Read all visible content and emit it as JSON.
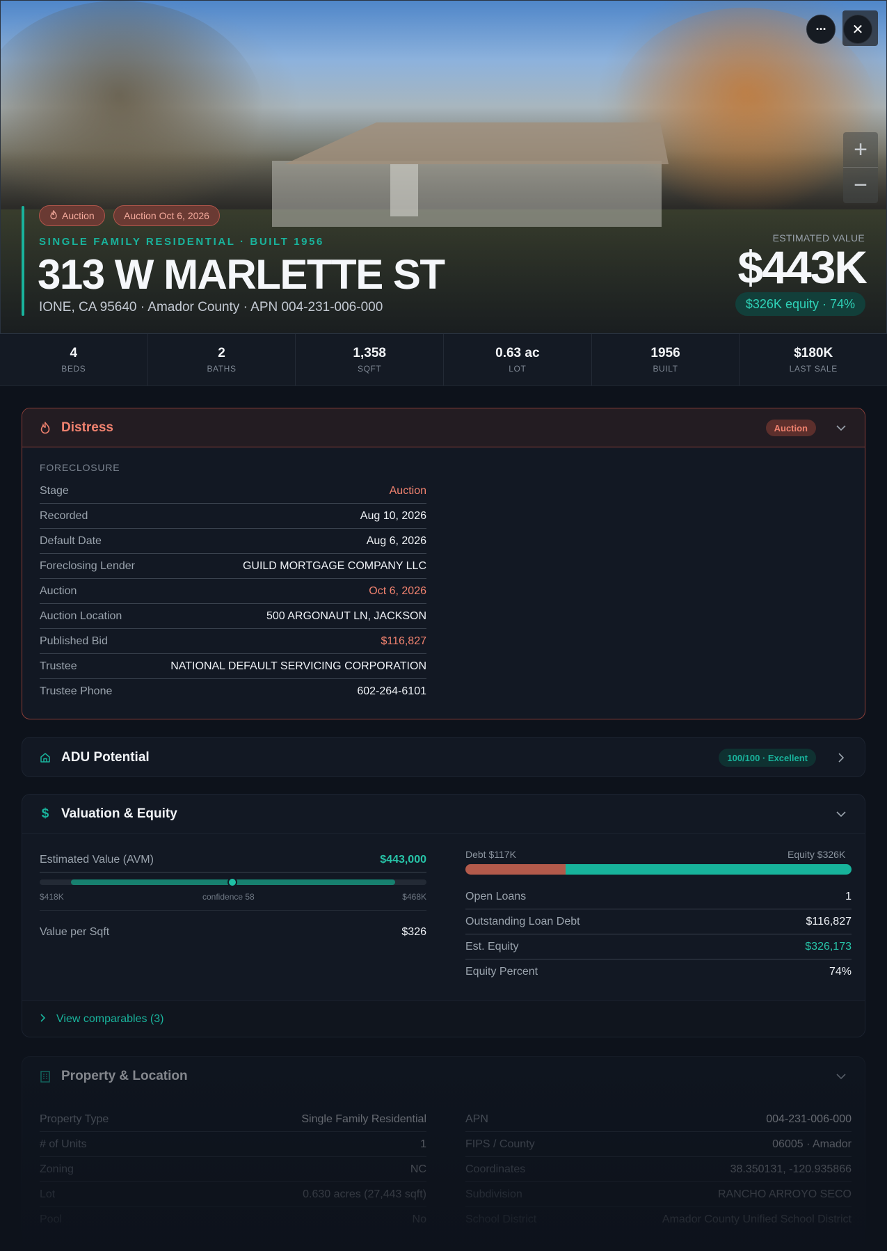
{
  "hero": {
    "chips": [
      {
        "label": "Auction"
      },
      {
        "label": "Auction Oct 6, 2026"
      }
    ],
    "kicker": "SINGLE FAMILY RESIDENTIAL · BUILT 1956",
    "address": "313 W MARLETTE ST",
    "subline": "IONE, CA 95640 · Amador County · APN 004-231-006-000",
    "estimated_label": "ESTIMATED VALUE",
    "estimated_value": "$443K",
    "equity_pill": "$326K equity · 74%",
    "more_glyph": "···",
    "close_glyph": "✕",
    "zoom_in_glyph": "+",
    "zoom_out_glyph": "−"
  },
  "stats": [
    {
      "value": "4",
      "label": "BEDS"
    },
    {
      "value": "2",
      "label": "BATHS"
    },
    {
      "value": "1,358",
      "label": "SQFT"
    },
    {
      "value": "0.63 ac",
      "label": "LOT"
    },
    {
      "value": "1956",
      "label": "BUILT"
    },
    {
      "value": "$180K",
      "label": "LAST SALE"
    }
  ],
  "distress": {
    "title": "Distress",
    "badge": "Auction",
    "section": "FORECLOSURE",
    "rows": [
      {
        "k": "Stage",
        "v": "Auction"
      },
      {
        "k": "Recorded",
        "v": "Aug 10, 2026"
      },
      {
        "k": "Default Date",
        "v": "Aug 6, 2026"
      },
      {
        "k": "Foreclosing Lender",
        "v": "GUILD MORTGAGE COMPANY LLC"
      },
      {
        "k": "Auction",
        "v": "Oct 6, 2026"
      },
      {
        "k": "Auction Location",
        "v": "500 ARGONAUT LN, JACKSON"
      },
      {
        "k": "Published Bid",
        "v": "$116,827"
      },
      {
        "k": "Trustee",
        "v": "NATIONAL DEFAULT SERVICING CORPORATION"
      },
      {
        "k": "Trustee Phone",
        "v": "602-264-6101"
      }
    ]
  },
  "adu": {
    "title": "ADU Potential",
    "score": "100/100 · Excellent"
  },
  "valuation": {
    "title": "Valuation & Equity",
    "avm_label": "Estimated Value (AVM)",
    "avm_value": "$443,000",
    "range_low": "$418K",
    "range_high": "$468K",
    "confidence": "confidence 58",
    "value_per_sqft_label": "Value per Sqft",
    "value_per_sqft": "$326",
    "debt_label": "Debt $117K",
    "equity_label": "Equity $326K",
    "debt_share": 0.26,
    "rows": [
      {
        "k": "Open Loans",
        "v": "1"
      },
      {
        "k": "Outstanding Loan Debt",
        "v": "$116,827"
      },
      {
        "k": "Est. Equity",
        "v": "$326,173"
      },
      {
        "k": "Equity Percent",
        "v": "74%"
      }
    ],
    "comparables": "View comparables (3)"
  },
  "property": {
    "title": "Property & Location",
    "left": [
      {
        "k": "Property Type",
        "v": "Single Family Residential"
      },
      {
        "k": "# of Units",
        "v": "1"
      },
      {
        "k": "Zoning",
        "v": "NC"
      },
      {
        "k": "Lot",
        "v": "0.630 acres (27,443 sqft)"
      },
      {
        "k": "Pool",
        "v": "No"
      }
    ],
    "right": [
      {
        "k": "APN",
        "v": "004-231-006-000"
      },
      {
        "k": "FIPS / County",
        "v": "06005 · Amador"
      },
      {
        "k": "Coordinates",
        "v": "38.350131, -120.935866"
      },
      {
        "k": "Subdivision",
        "v": "RANCHO ARROYO SECO"
      },
      {
        "k": "School District",
        "v": "Amador County Unified School District"
      }
    ]
  },
  "colors": {
    "accent": "#19b39c",
    "distress": "#f0826f",
    "background": "#0d121b"
  }
}
